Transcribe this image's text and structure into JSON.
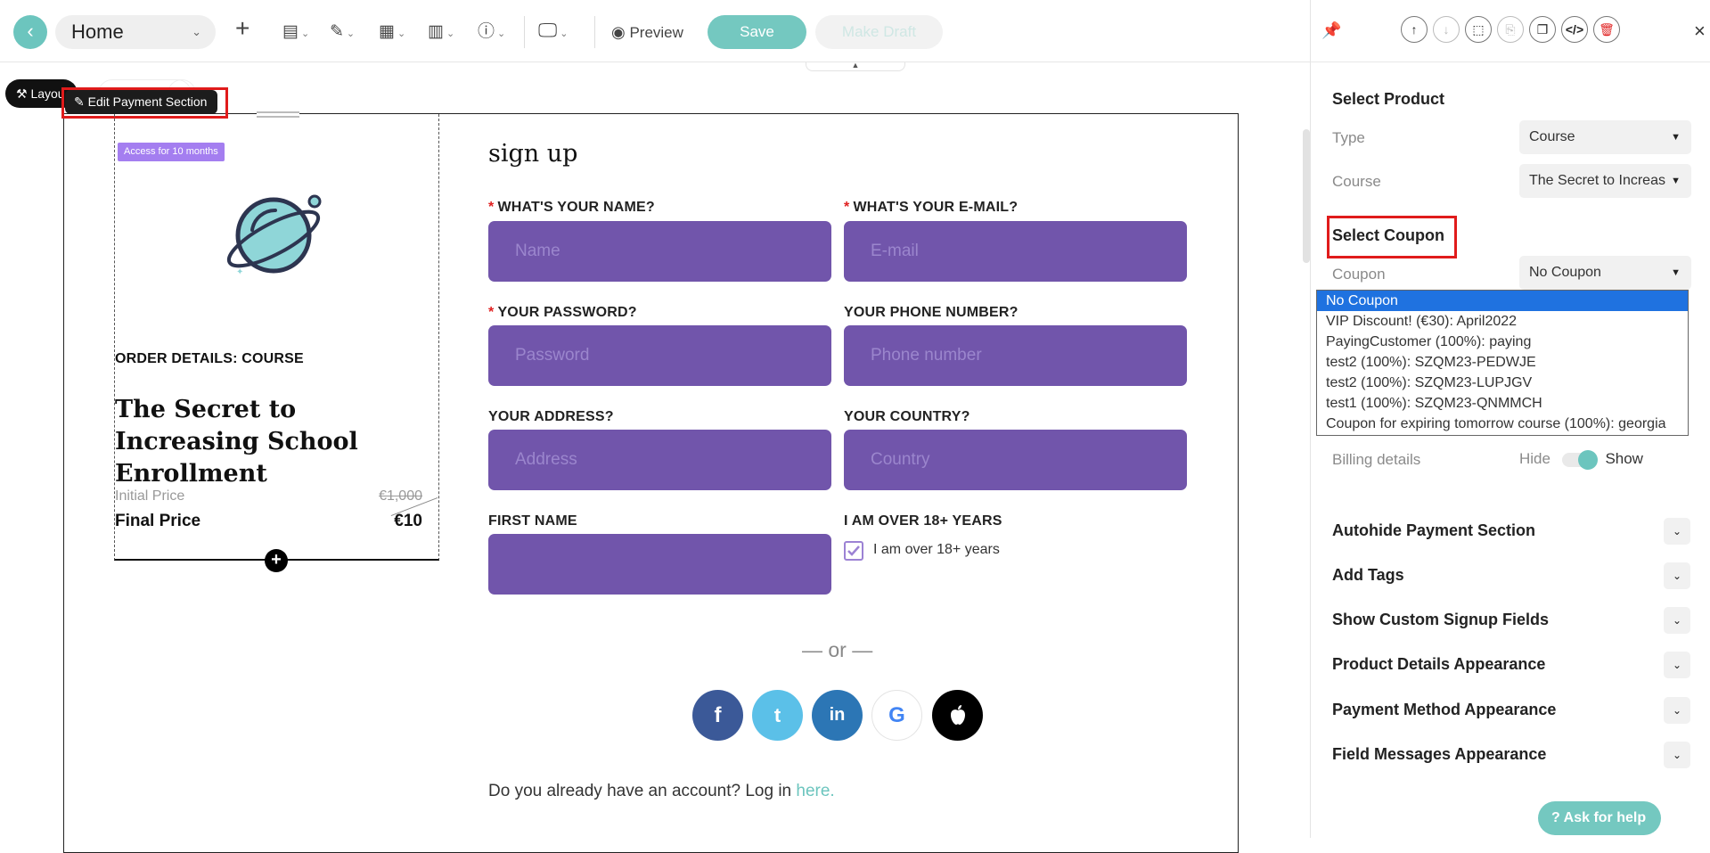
{
  "toolbar": {
    "back_icon": "chevron-left-icon",
    "page_name": "Home",
    "preview_label": "Preview",
    "save_label": "Save",
    "draft_label": "Make Draft"
  },
  "canvas": {
    "layout_chip": "Layou",
    "edit_chip": "Edit Payment Section"
  },
  "product": {
    "badge": "Access for 10 months",
    "order_title": "ORDER DETAILS: COURSE",
    "course_name": "The Secret to Increasing School Enrollment",
    "initial_price_label": "Initial Price",
    "initial_price_value": "€1,000",
    "final_price_label": "Final Price",
    "final_price_value": "€10"
  },
  "signup": {
    "title": "sign up",
    "fields": [
      {
        "label": "WHAT'S YOUR NAME?",
        "placeholder": "Name",
        "required": true
      },
      {
        "label": "WHAT'S YOUR E-MAIL?",
        "placeholder": "E-mail",
        "required": true
      },
      {
        "label": "YOUR PASSWORD?",
        "placeholder": "Password",
        "required": true
      },
      {
        "label": "YOUR PHONE NUMBER?",
        "placeholder": "Phone number",
        "required": false
      },
      {
        "label": "YOUR ADDRESS?",
        "placeholder": "Address",
        "required": false
      },
      {
        "label": "YOUR COUNTRY?",
        "placeholder": "Country",
        "required": false
      },
      {
        "label": "FIRST NAME",
        "placeholder": "",
        "required": false
      },
      {
        "label": "I AM OVER 18+ YEARS",
        "placeholder": "",
        "required": false
      }
    ],
    "checkbox_label": "I am over 18+ years",
    "or_text": "— or —",
    "social": [
      {
        "name": "facebook",
        "glyph": "f",
        "color": "#3b5998"
      },
      {
        "name": "twitter",
        "glyph": "t",
        "color": "#5bc0e8"
      },
      {
        "name": "linkedin",
        "glyph": "in",
        "color": "#2c76b5"
      },
      {
        "name": "google",
        "glyph": "G",
        "color": "#ffffff"
      },
      {
        "name": "apple",
        "glyph": "",
        "color": "#000000"
      }
    ],
    "login_prefix": "Do you already have an account? Log in ",
    "login_link": "here."
  },
  "sidebar": {
    "select_product_title": "Select Product",
    "type_label": "Type",
    "type_value": "Course",
    "course_label": "Course",
    "course_value": "The Secret to Increas",
    "select_coupon_title": "Select Coupon",
    "coupon_label": "Coupon",
    "coupon_value": "No Coupon",
    "coupon_options": [
      "No Coupon",
      "VIP Discount! (€30): April2022",
      "PayingCustomer (100%): paying",
      "test2 (100%): SZQM23-PEDWJE",
      "test2 (100%): SZQM23-LUPJGV",
      "test1 (100%): SZQM23-QNMMCH",
      "Coupon for expiring tomorrow course (100%): georgia"
    ],
    "billing_label": "Billing details",
    "billing_hide": "Hide",
    "billing_show": "Show",
    "accordions": [
      "Autohide Payment Section",
      "Add Tags",
      "Show Custom Signup Fields",
      "Product Details Appearance",
      "Payment Method Appearance",
      "Field Messages Appearance"
    ],
    "help_label": "Ask for help"
  },
  "colors": {
    "accent": "#6cc5be",
    "input_bg": "#7155ab",
    "highlight": "#e01b1b",
    "badge": "#a47ef0"
  }
}
